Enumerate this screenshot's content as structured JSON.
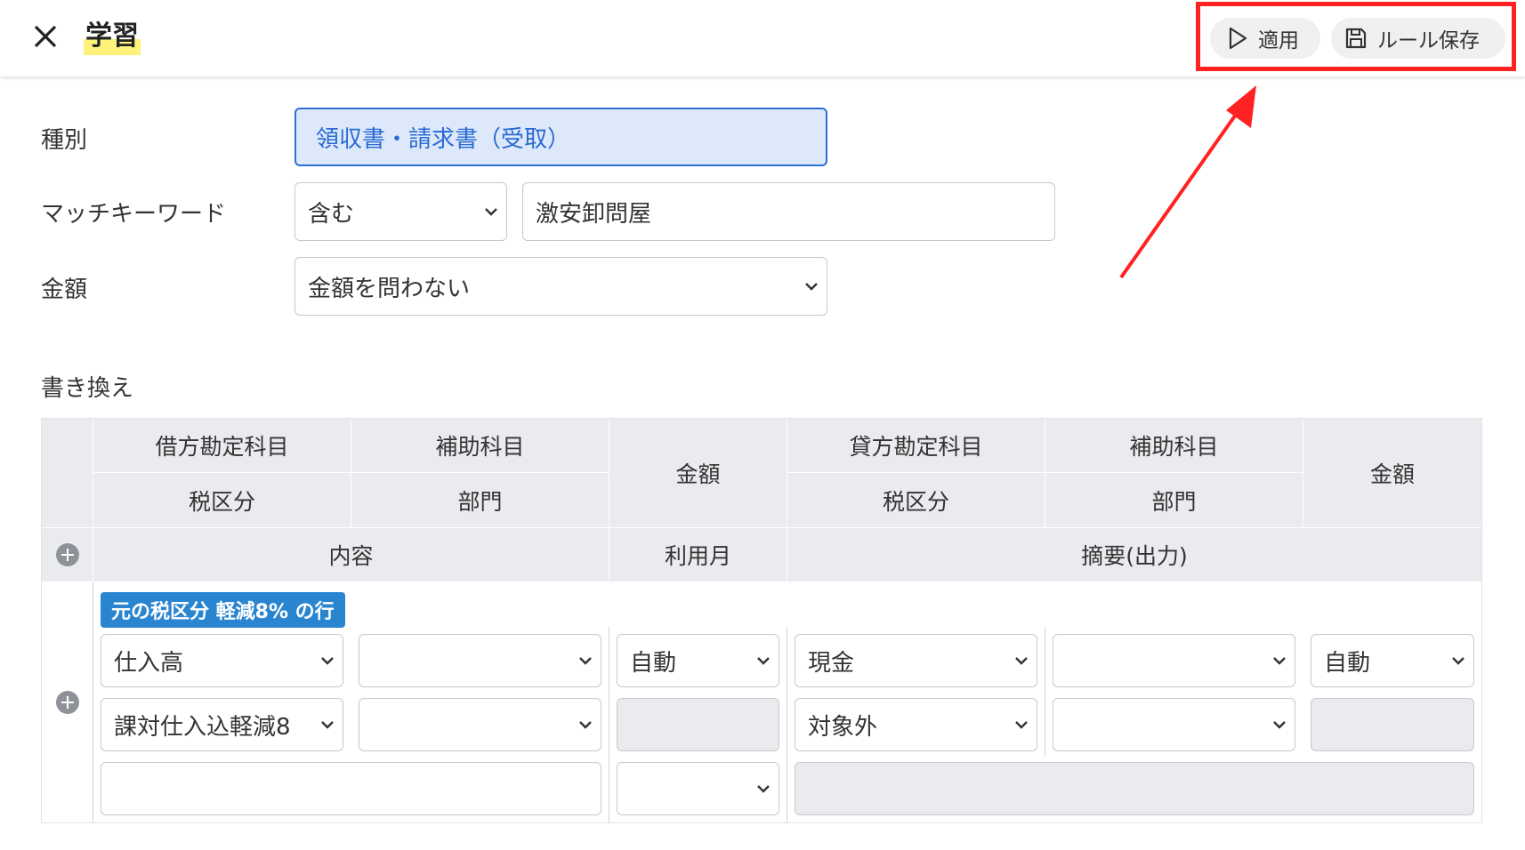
{
  "header": {
    "title": "学習",
    "apply_label": "適用",
    "save_label": "ルール保存"
  },
  "form": {
    "type_label": "種別",
    "type_value": "領収書・請求書（受取）",
    "keyword_label": "マッチキーワード",
    "keyword_condition": "含む",
    "keyword_value": "激安卸問屋",
    "amount_label": "金額",
    "amount_value": "金額を問わない",
    "rewrite_label": "書き換え"
  },
  "table": {
    "headers": {
      "debit_account": "借方勘定科目",
      "debit_sub": "補助科目",
      "debit_tax": "税区分",
      "debit_dept": "部門",
      "amount_left": "金額",
      "credit_account": "貸方勘定科目",
      "credit_sub": "補助科目",
      "credit_tax": "税区分",
      "credit_dept": "部門",
      "amount_right": "金額",
      "content": "内容",
      "usage_month": "利用月",
      "memo": "摘要(出力)"
    },
    "row": {
      "badge": "元の税区分 軽減8% の行",
      "debit_account": "仕入高",
      "debit_sub": "",
      "amount_left": "自動",
      "credit_account": "現金",
      "credit_sub": "",
      "amount_right": "自動",
      "debit_tax": "課対仕入込軽減8",
      "debit_dept": "",
      "credit_tax": "対象外",
      "credit_dept": "",
      "content": "",
      "usage_month": "",
      "memo": ""
    }
  },
  "colors": {
    "accent_blue": "#2c6fd8",
    "badge_blue": "#2a85d0",
    "highlight_red": "#f22",
    "title_marker": "#fff27a"
  }
}
